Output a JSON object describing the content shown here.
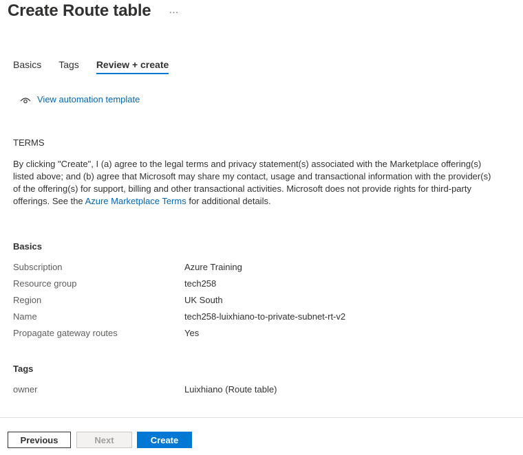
{
  "header": {
    "title": "Create Route table",
    "more": "···"
  },
  "tabs": [
    {
      "label": "Basics"
    },
    {
      "label": "Tags"
    },
    {
      "label": "Review + create"
    }
  ],
  "automation": {
    "icon": "eye-icon",
    "label": "View automation template"
  },
  "terms": {
    "heading": "TERMS",
    "text_before": "By clicking \"Create\", I (a) agree to the legal terms and privacy statement(s) associated with the Marketplace offering(s) listed above; and (b) agree that Microsoft may share my contact, usage and transactional information with the provider(s) of the offering(s) for support, billing and other transactional activities. Microsoft does not provide rights for third-party offerings. See the ",
    "link": "Azure Marketplace Terms",
    "text_after": " for additional details."
  },
  "basics": {
    "heading": "Basics",
    "rows": [
      {
        "key": "Subscription",
        "value": "Azure Training"
      },
      {
        "key": "Resource group",
        "value": "tech258"
      },
      {
        "key": "Region",
        "value": "UK South"
      },
      {
        "key": "Name",
        "value": "tech258-luixhiano-to-private-subnet-rt-v2"
      },
      {
        "key": "Propagate gateway routes",
        "value": "Yes"
      }
    ]
  },
  "tags": {
    "heading": "Tags",
    "rows": [
      {
        "key": "owner",
        "value": "Luixhiano (Route table)"
      }
    ]
  },
  "footer": {
    "previous": "Previous",
    "next": "Next",
    "create": "Create"
  },
  "colors": {
    "accent": "#0078d4",
    "link": "#0067b8",
    "text": "#323130"
  }
}
